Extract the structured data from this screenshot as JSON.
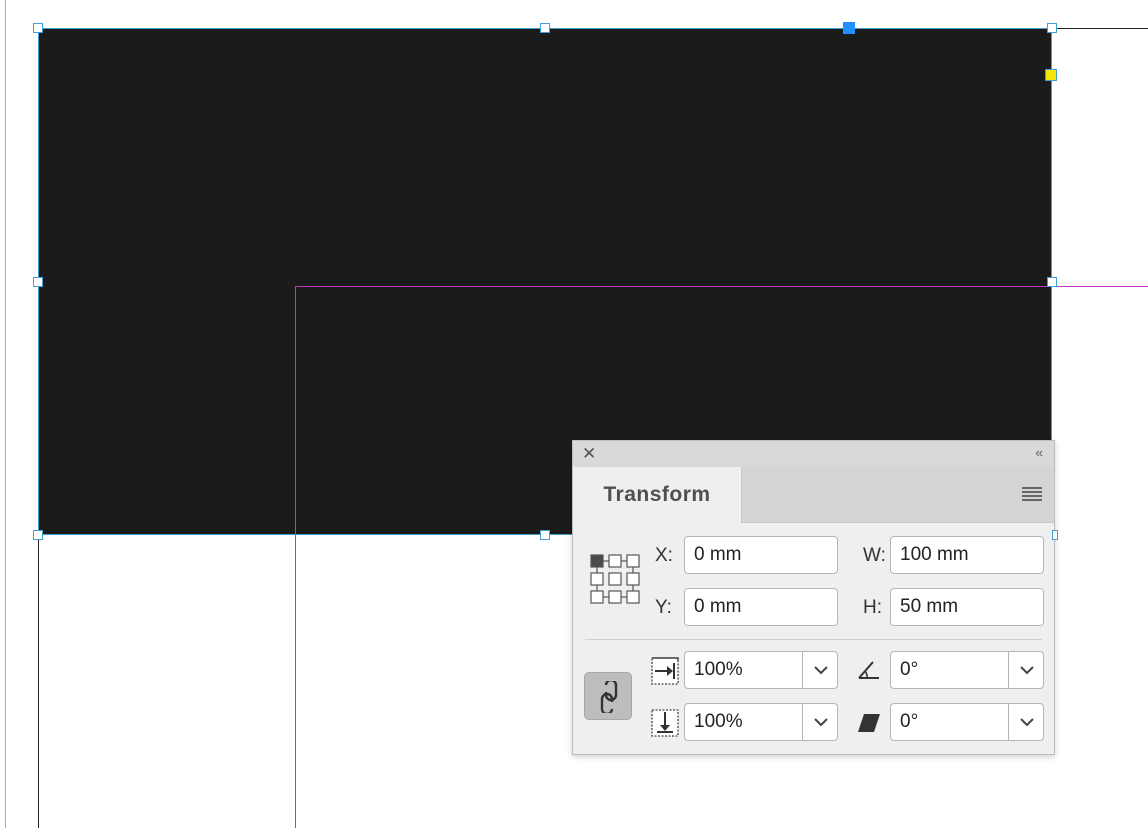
{
  "panel": {
    "title": "Transform",
    "close_glyph": "✕",
    "collapse_glyph": "‹‹",
    "x_label": "X:",
    "y_label": "Y:",
    "w_label": "W:",
    "h_label": "H:",
    "x_value": "0 mm",
    "y_value": "0 mm",
    "w_value": "100 mm",
    "h_value": "50 mm",
    "scale_x_value": "100%",
    "scale_y_value": "100%",
    "rotation_value": "0°",
    "shear_value": "0°",
    "reference_point": "top-left"
  },
  "colors": {
    "frame_fill": "#1b1b1b",
    "selection": "#3ea0d6",
    "margin_guide": "#c036c0",
    "bleed_guide": "#e0409a"
  },
  "icons": [
    "close-icon",
    "collapse-icon",
    "panel-menu-icon",
    "reference-point-icon",
    "constrain-proportions-icon",
    "scale-x-icon",
    "scale-y-icon",
    "rotation-icon",
    "shear-icon",
    "chevron-down-icon"
  ]
}
